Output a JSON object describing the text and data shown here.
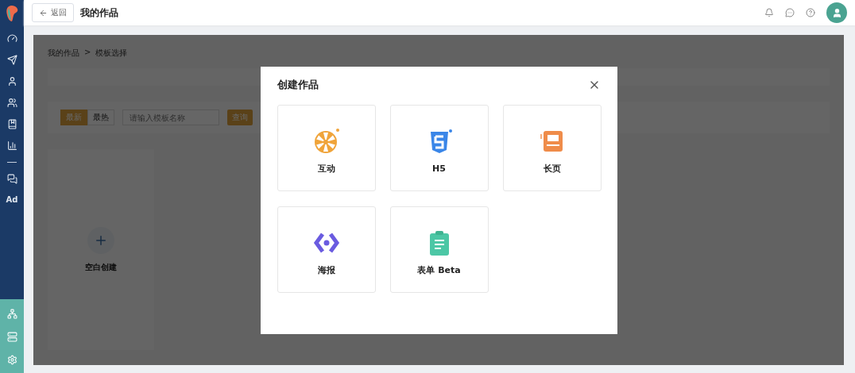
{
  "header": {
    "back_button": "返回",
    "title": "我的作品"
  },
  "sidebar": {
    "ad_label": "Ad"
  },
  "breadcrumb": {
    "items": [
      "我的作品",
      "模板选择"
    ],
    "separator": ">"
  },
  "filter": {
    "tabs": [
      {
        "label": "最新",
        "selected": true
      },
      {
        "label": "最热",
        "selected": false
      }
    ],
    "search": {
      "placeholder": "请输入模板名称"
    },
    "query_button": "查询"
  },
  "blank_card": {
    "label": "空白创建"
  },
  "modal": {
    "title": "创建作品",
    "options": [
      {
        "kind": "interactive",
        "label": "互动"
      },
      {
        "kind": "h5",
        "label": "H5"
      },
      {
        "kind": "long_page",
        "label": "长页"
      },
      {
        "kind": "poster",
        "label": "海报"
      },
      {
        "kind": "form",
        "label": "表单 Beta"
      }
    ]
  }
}
